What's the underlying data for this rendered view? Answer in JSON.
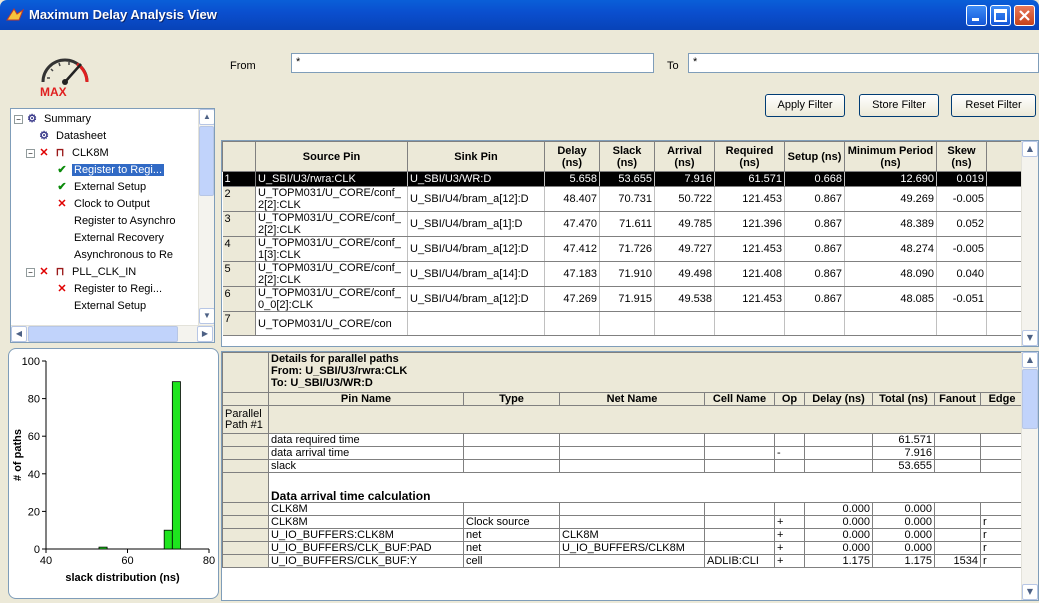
{
  "window": {
    "title": "Maximum Delay Analysis View"
  },
  "logo": {
    "text": "MAX"
  },
  "tree": {
    "summary": "Summary",
    "datasheet": "Datasheet",
    "clk8m": "CLK8M",
    "reg_to_reg": "Register to Regi...",
    "external_setup": "External Setup",
    "clock_to_output": "Clock to Output",
    "reg_to_async": "Register to Asynchro",
    "external_recovery": "External Recovery",
    "async_to_reg": "Asynchronous to Re",
    "pll_clk_in": "PLL_CLK_IN",
    "pll_reg_to_reg": "Register to Regi...",
    "pll_external_setup": "External Setup"
  },
  "chart_data": {
    "type": "bar",
    "xlabel": "slack distribution (ns)",
    "ylabel": "# of paths",
    "xlim": [
      40,
      80
    ],
    "ylim": [
      0,
      100
    ],
    "x_ticks": [
      "40",
      "60",
      "80"
    ],
    "y_ticks": [
      "0",
      "20",
      "40",
      "60",
      "80",
      "100"
    ],
    "bars": [
      {
        "x": 54,
        "value": 1
      },
      {
        "x": 70,
        "value": 10
      },
      {
        "x": 72,
        "value": 89
      }
    ],
    "bar_color": "#1ee51e"
  },
  "filter": {
    "from_label": "From",
    "from_value": "*",
    "to_label": "To",
    "to_value": "*",
    "apply_label": "Apply Filter",
    "store_label": "Store Filter",
    "reset_label": "Reset Filter"
  },
  "paths_table": {
    "columns": {
      "source": "Source Pin",
      "sink": "Sink Pin",
      "delay": "Delay (ns)",
      "slack": "Slack (ns)",
      "arrival": "Arrival (ns)",
      "required": "Required (ns)",
      "setup": "Setup (ns)",
      "min_period": "Minimum Period (ns)",
      "skew": "Skew (ns)"
    },
    "rows": [
      {
        "n": "1",
        "source": "U_SBI/U3/rwra:CLK",
        "sink": "U_SBI/U3/WR:D",
        "delay": "5.658",
        "slack": "53.655",
        "arrival": "7.916",
        "required": "61.571",
        "setup": "0.668",
        "min_period": "12.690",
        "skew": "0.019"
      },
      {
        "n": "2",
        "source": "U_TOPM031/U_CORE/conf_2[2]:CLK",
        "sink": "U_SBI/U4/bram_a[12]:D",
        "delay": "48.407",
        "slack": "70.731",
        "arrival": "50.722",
        "required": "121.453",
        "setup": "0.867",
        "min_period": "49.269",
        "skew": "-0.005"
      },
      {
        "n": "3",
        "source": "U_TOPM031/U_CORE/conf_2[2]:CLK",
        "sink": "U_SBI/U4/bram_a[1]:D",
        "delay": "47.470",
        "slack": "71.611",
        "arrival": "49.785",
        "required": "121.396",
        "setup": "0.867",
        "min_period": "48.389",
        "skew": "0.052"
      },
      {
        "n": "4",
        "source": "U_TOPM031/U_CORE/conf_1[3]:CLK",
        "sink": "U_SBI/U4/bram_a[12]:D",
        "delay": "47.412",
        "slack": "71.726",
        "arrival": "49.727",
        "required": "121.453",
        "setup": "0.867",
        "min_period": "48.274",
        "skew": "-0.005"
      },
      {
        "n": "5",
        "source": "U_TOPM031/U_CORE/conf_2[2]:CLK",
        "sink": "U_SBI/U4/bram_a[14]:D",
        "delay": "47.183",
        "slack": "71.910",
        "arrival": "49.498",
        "required": "121.408",
        "setup": "0.867",
        "min_period": "48.090",
        "skew": "0.040"
      },
      {
        "n": "6",
        "source": "U_TOPM031/U_CORE/conf_0_0[2]:CLK",
        "sink": "U_SBI/U4/bram_a[12]:D",
        "delay": "47.269",
        "slack": "71.915",
        "arrival": "49.538",
        "required": "121.453",
        "setup": "0.867",
        "min_period": "48.085",
        "skew": "-0.051"
      },
      {
        "n": "7",
        "source": "U_TOPM031/U_CORE/con",
        "sink": "",
        "delay": "",
        "slack": "",
        "arrival": "",
        "required": "",
        "setup": "",
        "min_period": "",
        "skew": ""
      }
    ]
  },
  "details": {
    "title": "Details for parallel paths",
    "from": "From: U_SBI/U3/rwra:CLK",
    "to": "To: U_SBI/U3/WR:D",
    "columns": {
      "pin": "Pin Name",
      "type": "Type",
      "net": "Net Name",
      "cell": "Cell Name",
      "op": "Op",
      "delay": "Delay (ns)",
      "total": "Total (ns)",
      "fanout": "Fanout",
      "edge": "Edge"
    },
    "parallel_label": "Parallel Path #1",
    "summary_rows": [
      {
        "pin": "data required time",
        "op": "",
        "total": "61.571"
      },
      {
        "pin": "data arrival time",
        "op": "-",
        "total": "7.916"
      },
      {
        "pin": "slack",
        "op": "",
        "total": "53.655"
      }
    ],
    "arrival_header": "Data arrival time calculation",
    "arrival_rows": [
      {
        "pin": "CLK8M",
        "type": "",
        "net": "",
        "cell": "",
        "op": "",
        "delay": "0.000",
        "total": "0.000",
        "fanout": "",
        "edge": ""
      },
      {
        "pin": "CLK8M",
        "type": "Clock source",
        "net": "",
        "cell": "",
        "op": "+",
        "delay": "0.000",
        "total": "0.000",
        "fanout": "",
        "edge": "r"
      },
      {
        "pin": "U_IO_BUFFERS:CLK8M",
        "type": "net",
        "net": "CLK8M",
        "cell": "",
        "op": "+",
        "delay": "0.000",
        "total": "0.000",
        "fanout": "",
        "edge": "r"
      },
      {
        "pin": "U_IO_BUFFERS/CLK_BUF:PAD",
        "type": "net",
        "net": "U_IO_BUFFERS/CLK8M",
        "cell": "",
        "op": "+",
        "delay": "0.000",
        "total": "0.000",
        "fanout": "",
        "edge": "r"
      },
      {
        "pin": "U_IO_BUFFERS/CLK_BUF:Y",
        "type": "cell",
        "net": "",
        "cell": "ADLIB:CLI",
        "op": "+",
        "delay": "1.175",
        "total": "1.175",
        "fanout": "1534",
        "edge": "r"
      }
    ]
  }
}
